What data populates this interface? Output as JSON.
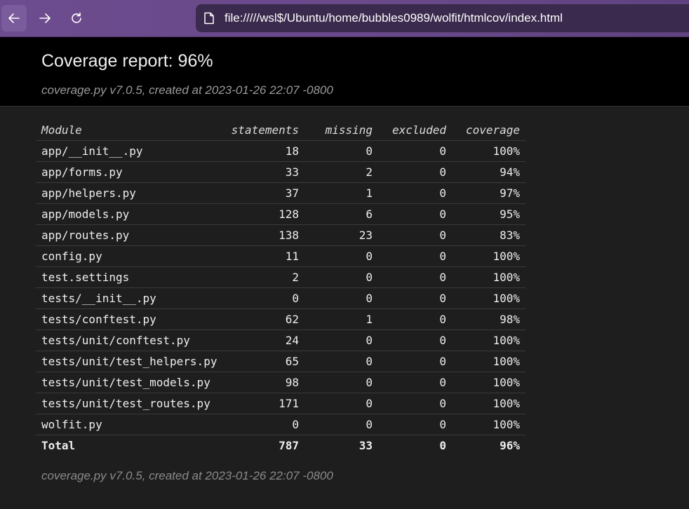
{
  "browser": {
    "url": "file://///wsl$/Ubuntu/home/bubbles0989/wolfit/htmlcov/index.html"
  },
  "header": {
    "title": "Coverage report: 96%",
    "created": "coverage.py v7.0.5, created at 2023-01-26 22:07 -0800"
  },
  "table": {
    "columns": [
      "Module",
      "statements",
      "missing",
      "excluded",
      "coverage"
    ],
    "rows": [
      [
        "app/__init__.py",
        "18",
        "0",
        "0",
        "100%"
      ],
      [
        "app/forms.py",
        "33",
        "2",
        "0",
        "94%"
      ],
      [
        "app/helpers.py",
        "37",
        "1",
        "0",
        "97%"
      ],
      [
        "app/models.py",
        "128",
        "6",
        "0",
        "95%"
      ],
      [
        "app/routes.py",
        "138",
        "23",
        "0",
        "83%"
      ],
      [
        "config.py",
        "11",
        "0",
        "0",
        "100%"
      ],
      [
        "test.settings",
        "2",
        "0",
        "0",
        "100%"
      ],
      [
        "tests/__init__.py",
        "0",
        "0",
        "0",
        "100%"
      ],
      [
        "tests/conftest.py",
        "62",
        "1",
        "0",
        "98%"
      ],
      [
        "tests/unit/conftest.py",
        "24",
        "0",
        "0",
        "100%"
      ],
      [
        "tests/unit/test_helpers.py",
        "65",
        "0",
        "0",
        "100%"
      ],
      [
        "tests/unit/test_models.py",
        "98",
        "0",
        "0",
        "100%"
      ],
      [
        "tests/unit/test_routes.py",
        "171",
        "0",
        "0",
        "100%"
      ],
      [
        "wolfit.py",
        "0",
        "0",
        "0",
        "100%"
      ]
    ],
    "total": [
      "Total",
      "787",
      "33",
      "0",
      "96%"
    ]
  },
  "footer": {
    "created": "coverage.py v7.0.5, created at 2023-01-26 22:07 -0800"
  }
}
